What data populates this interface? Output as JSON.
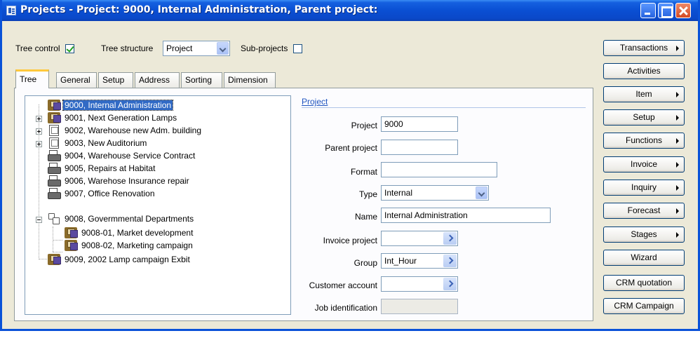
{
  "window": {
    "title": "Projects - Project: 9000, Internal Administration, Parent project:"
  },
  "toolbar": {
    "tree_control_label": "Tree control",
    "tree_control_checked": true,
    "tree_structure_label": "Tree structure",
    "tree_structure_value": "Project",
    "subprojects_label": "Sub-projects",
    "subprojects_checked": false
  },
  "tabs": [
    "Tree",
    "General",
    "Setup",
    "Address",
    "Sorting",
    "Dimension"
  ],
  "active_tab": "Tree",
  "tree": {
    "items": [
      {
        "label": "9000, Internal Administration",
        "icon": "project-folder-icon",
        "selected": true
      },
      {
        "label": "9001, Next Generation Lamps",
        "icon": "project-folder-icon"
      },
      {
        "label": "9002, Warehouse new Adm. building",
        "icon": "document-icon"
      },
      {
        "label": "9003, New Auditorium",
        "icon": "document-icon"
      },
      {
        "label": "9004, Warehouse Service Contract",
        "icon": "printer-icon"
      },
      {
        "label": "9005, Repairs at Habitat",
        "icon": "printer-icon"
      },
      {
        "label": "9006, Warehose Insurance repair",
        "icon": "printer-icon"
      },
      {
        "label": "9007, Office Renovation",
        "icon": "printer-icon"
      },
      {
        "label": "9008, Govermmental Departments",
        "icon": "group-icon"
      },
      {
        "label": "9008-01, Market development",
        "icon": "project-folder-icon"
      },
      {
        "label": "9008-02, Marketing campaign",
        "icon": "project-folder-icon"
      },
      {
        "label": "9009, 2002 Lamp campaign Exbit",
        "icon": "project-folder-icon"
      }
    ]
  },
  "project_group": {
    "title": "Project",
    "fields": {
      "project": {
        "label": "Project",
        "value": "9000"
      },
      "parent_project": {
        "label": "Parent project",
        "value": ""
      },
      "format": {
        "label": "Format",
        "value": ""
      },
      "type": {
        "label": "Type",
        "value": "Internal"
      },
      "name": {
        "label": "Name",
        "value": "Internal Administration"
      },
      "invoice_project": {
        "label": "Invoice project",
        "value": ""
      },
      "group": {
        "label": "Group",
        "value": "Int_Hour"
      },
      "customer_account": {
        "label": "Customer account",
        "value": ""
      },
      "job_identification": {
        "label": "Job identification",
        "value": ""
      }
    }
  },
  "buttons": [
    {
      "label": "Transactions",
      "submenu": true
    },
    {
      "label": "Activities",
      "submenu": false
    },
    {
      "label": "Item",
      "submenu": true
    },
    {
      "label": "Setup",
      "submenu": true
    },
    {
      "label": "Functions",
      "submenu": true
    },
    {
      "label": "Invoice",
      "submenu": true
    },
    {
      "label": "Inquiry",
      "submenu": true
    },
    {
      "label": "Forecast",
      "submenu": true
    },
    {
      "label": "Stages",
      "submenu": true
    },
    {
      "label": "Wizard",
      "submenu": false
    },
    {
      "label": "CRM quotation",
      "submenu": false
    },
    {
      "label": "CRM Campaign",
      "submenu": false
    }
  ],
  "colors": {
    "titlebar": "#0a4fd3",
    "selection": "#316ac5",
    "tab_highlight": "#ffc83c",
    "window_bg": "#ece9d8"
  }
}
